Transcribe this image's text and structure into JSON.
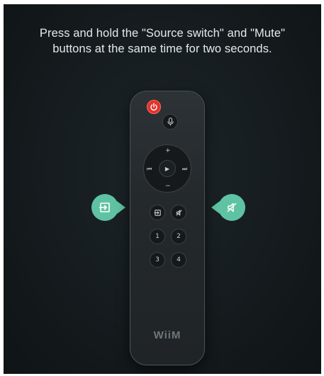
{
  "instruction": {
    "line1": "Press and hold the \"Source switch\" and \"Mute\"",
    "line2": "buttons at the same time for two seconds."
  },
  "remote": {
    "brand": "WiiM",
    "dpad": {
      "up": "+",
      "down": "−",
      "prev": "⏮",
      "next": "⏭",
      "play": "▶"
    },
    "number_buttons": [
      "1",
      "2",
      "3",
      "4"
    ]
  },
  "callouts": {
    "left_icon": "source-switch-icon",
    "right_icon": "mute-icon"
  },
  "colors": {
    "background": "#151b1e",
    "accent": "#5fc3a3",
    "power": "#e2322b",
    "text": "#e6e9ea"
  }
}
